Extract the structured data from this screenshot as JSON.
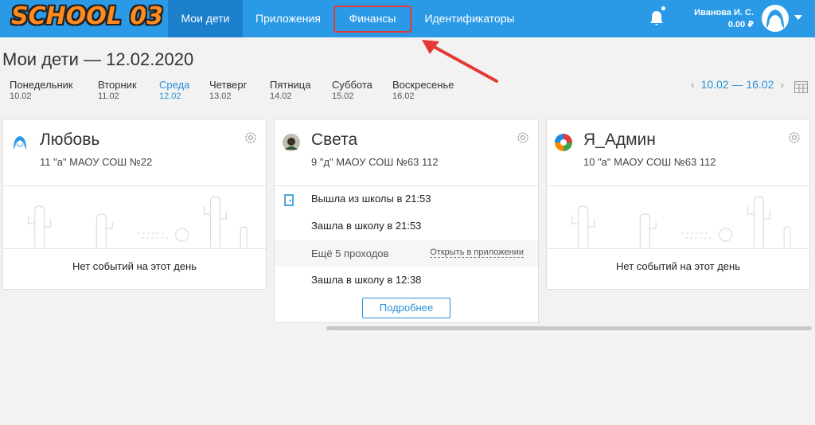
{
  "header": {
    "logo": "SCHOOL 03",
    "nav": [
      {
        "label": "Мои дети",
        "active": true
      },
      {
        "label": "Приложения",
        "active": false
      },
      {
        "label": "Финансы",
        "active": false
      },
      {
        "label": "Идентификаторы",
        "active": false
      }
    ],
    "user_name": "Иванова И. С.",
    "balance": "0.00 ₽",
    "icons": [
      "bell-icon",
      "avatar-icon",
      "chevron-down-icon"
    ]
  },
  "page": {
    "title": "Мои дети — 12.02.2020",
    "week_range": "10.02 — 16.02",
    "days": [
      {
        "name": "Понедельник",
        "date": "10.02"
      },
      {
        "name": "Вторник",
        "date": "11.02"
      },
      {
        "name": "Среда",
        "date": "12.02"
      },
      {
        "name": "Четверг",
        "date": "13.02"
      },
      {
        "name": "Пятница",
        "date": "14.02"
      },
      {
        "name": "Суббота",
        "date": "15.02"
      },
      {
        "name": "Воскресенье",
        "date": "16.02"
      }
    ],
    "active_day": "Среда"
  },
  "cards": [
    {
      "name": "Любовь",
      "school": "11 \"а\" МАОУ СОШ №22",
      "empty_text": "Нет событий на этот день"
    },
    {
      "name": "Света",
      "school": "9 \"д\" МАОУ СОШ №63 112",
      "events": [
        "Вышла из школы в 21:53",
        "Зашла в школу в 21:53",
        "Зашла в школу в 12:38"
      ],
      "more_text": "Ещё 5 проходов",
      "more_link": "Открыть в приложении",
      "details_button": "Подробнее"
    },
    {
      "name": "Я_Админ",
      "school": "10 \"а\" МАОУ СОШ №63 112",
      "empty_text": "Нет событий на этот день"
    }
  ],
  "colors": {
    "header": "#2a9ae6",
    "nav_active": "#1b7fcc",
    "accent": "#2a8fd9",
    "highlight": "#e53935",
    "logo": "#ff8a1f"
  }
}
